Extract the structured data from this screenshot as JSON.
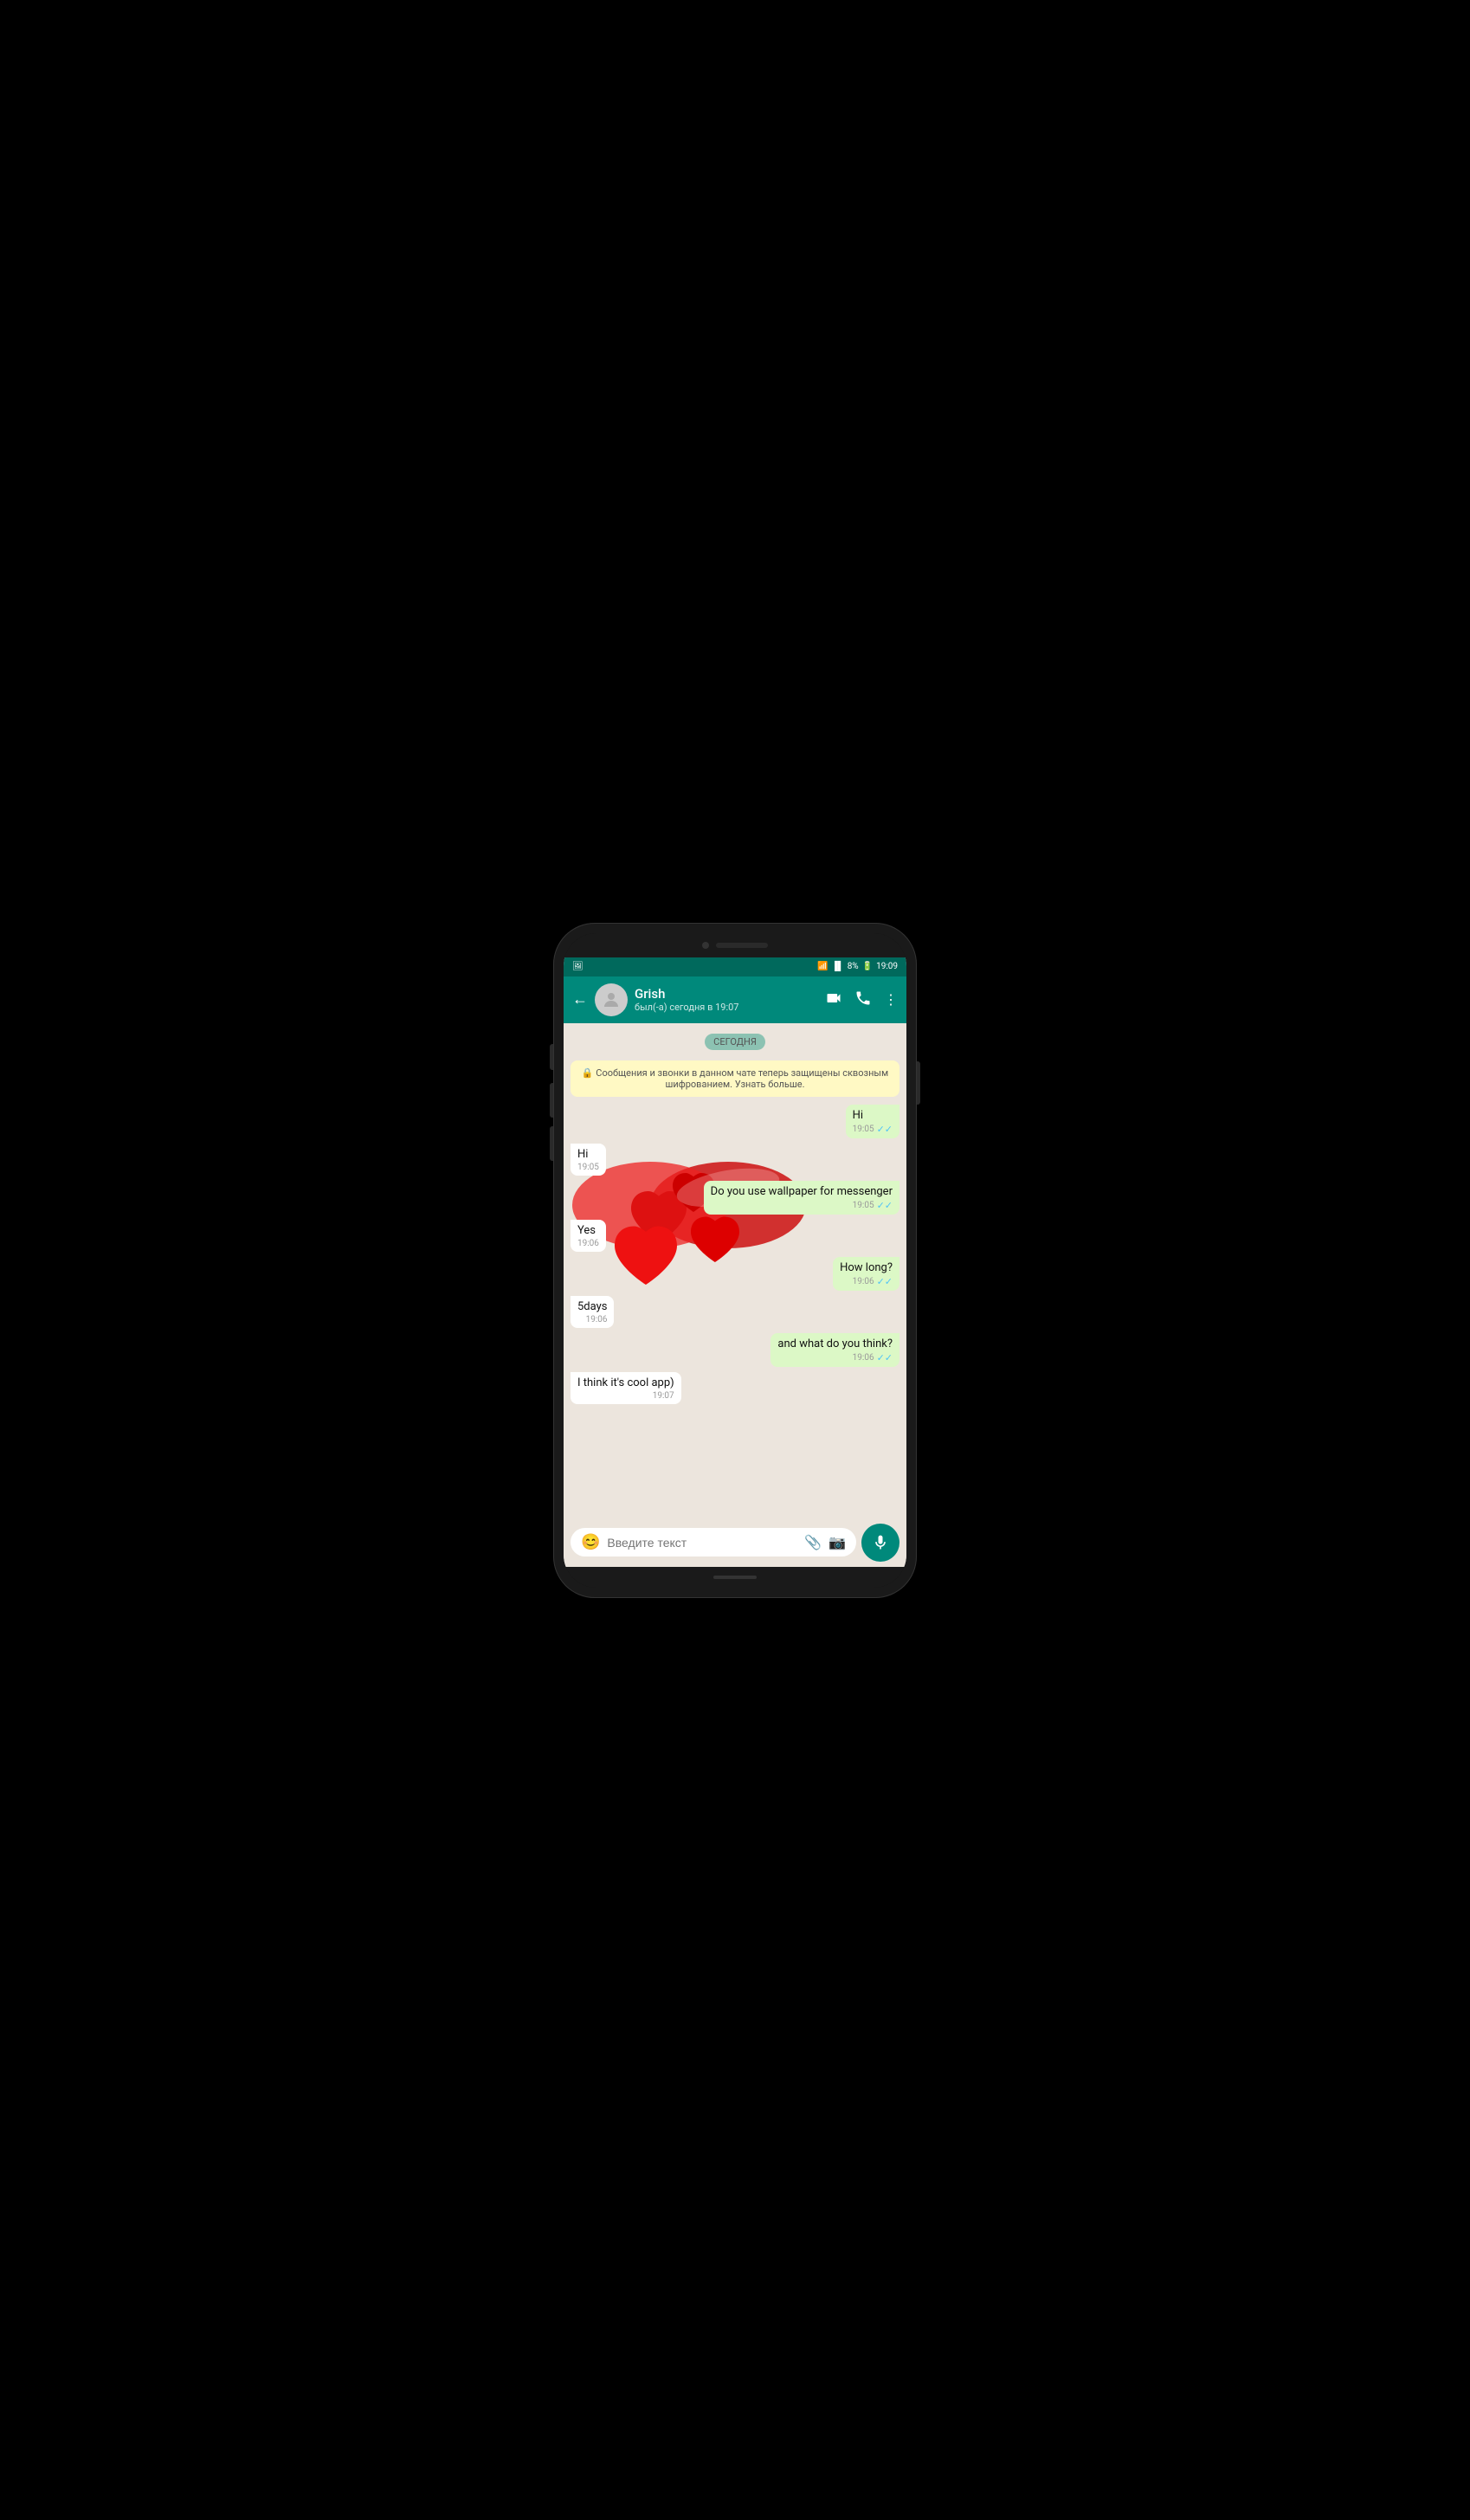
{
  "phone": {
    "status_bar": {
      "time": "19:09",
      "battery": "8%",
      "wifi": true,
      "signal": true
    },
    "header": {
      "back_label": "←",
      "contact_name": "Grish",
      "contact_status": "был(-а) сегодня в 19:07",
      "video_icon": "video-camera",
      "phone_icon": "phone",
      "more_icon": "more-vertical"
    },
    "chat": {
      "date_chip": "СЕГОДНЯ",
      "system_message": "🔒 Сообщения и звонки в данном чате теперь защищены сквозным шифрованием. Узнать больше.",
      "messages": [
        {
          "id": 1,
          "type": "sent",
          "text": "Hi",
          "time": "19:05",
          "read": true
        },
        {
          "id": 2,
          "type": "received",
          "text": "Hi",
          "time": "19:05"
        },
        {
          "id": 3,
          "type": "sent",
          "text": "Do you use wallpaper for messenger",
          "time": "19:05",
          "read": true
        },
        {
          "id": 4,
          "type": "received",
          "text": "Yes",
          "time": "19:06"
        },
        {
          "id": 5,
          "type": "sent",
          "text": "How long?",
          "time": "19:06",
          "read": true
        },
        {
          "id": 6,
          "type": "received",
          "text": "5days",
          "time": "19:06"
        },
        {
          "id": 7,
          "type": "sent",
          "text": "and what do you think?",
          "time": "19:06",
          "read": true
        },
        {
          "id": 8,
          "type": "received",
          "text": "I think it's cool app)",
          "time": "19:07"
        }
      ]
    },
    "input": {
      "placeholder": "Введите текст",
      "emoji_label": "😊",
      "attach_label": "📎",
      "camera_label": "📷",
      "mic_label": "mic"
    }
  }
}
